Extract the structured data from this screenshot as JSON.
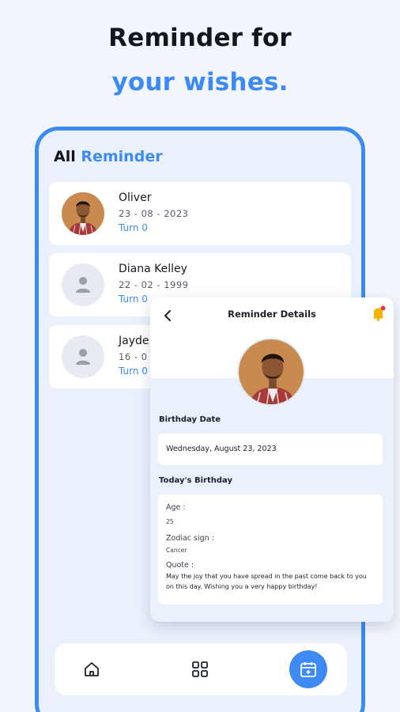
{
  "headline": {
    "line1": "Reminder for",
    "line2": "your wishes."
  },
  "list": {
    "title_prefix": "All",
    "title_accent": "Reminder",
    "items": [
      {
        "name": "Oliver",
        "date": "23 - 08 - 2023",
        "turn": "Turn 0",
        "avatar": "person-photo"
      },
      {
        "name": "Diana Kelley",
        "date": "22 - 02 - 1999",
        "turn": "Turn 0",
        "avatar": "person-placeholder-icon"
      },
      {
        "name": "Jayde",
        "date": "16 - 0",
        "turn": "Turn 0",
        "avatar": "person-placeholder-icon"
      }
    ]
  },
  "nav": {
    "items": [
      "home-icon",
      "grid-icon",
      "calendar-icon"
    ],
    "active": "calendar-icon"
  },
  "details": {
    "title": "Reminder Details",
    "birthday_label": "Birthday Date",
    "birthday_value": "Wednesday, August 23, 2023",
    "today_label": "Today's Birthday",
    "age_label": "Age :",
    "age_value": "25",
    "zodiac_label": "Zodiac sign :",
    "zodiac_value": "Cancer",
    "quote_label": "Quote :",
    "quote_value": "May the joy that you have spread in the past come back to you on this day. Wishing you a very happy birthday!"
  },
  "colors": {
    "accent": "#3D8BF2",
    "background": "#F2F6FC",
    "panel": "#EAF1FD",
    "notification": "#E53935",
    "bell": "#F5B300"
  }
}
